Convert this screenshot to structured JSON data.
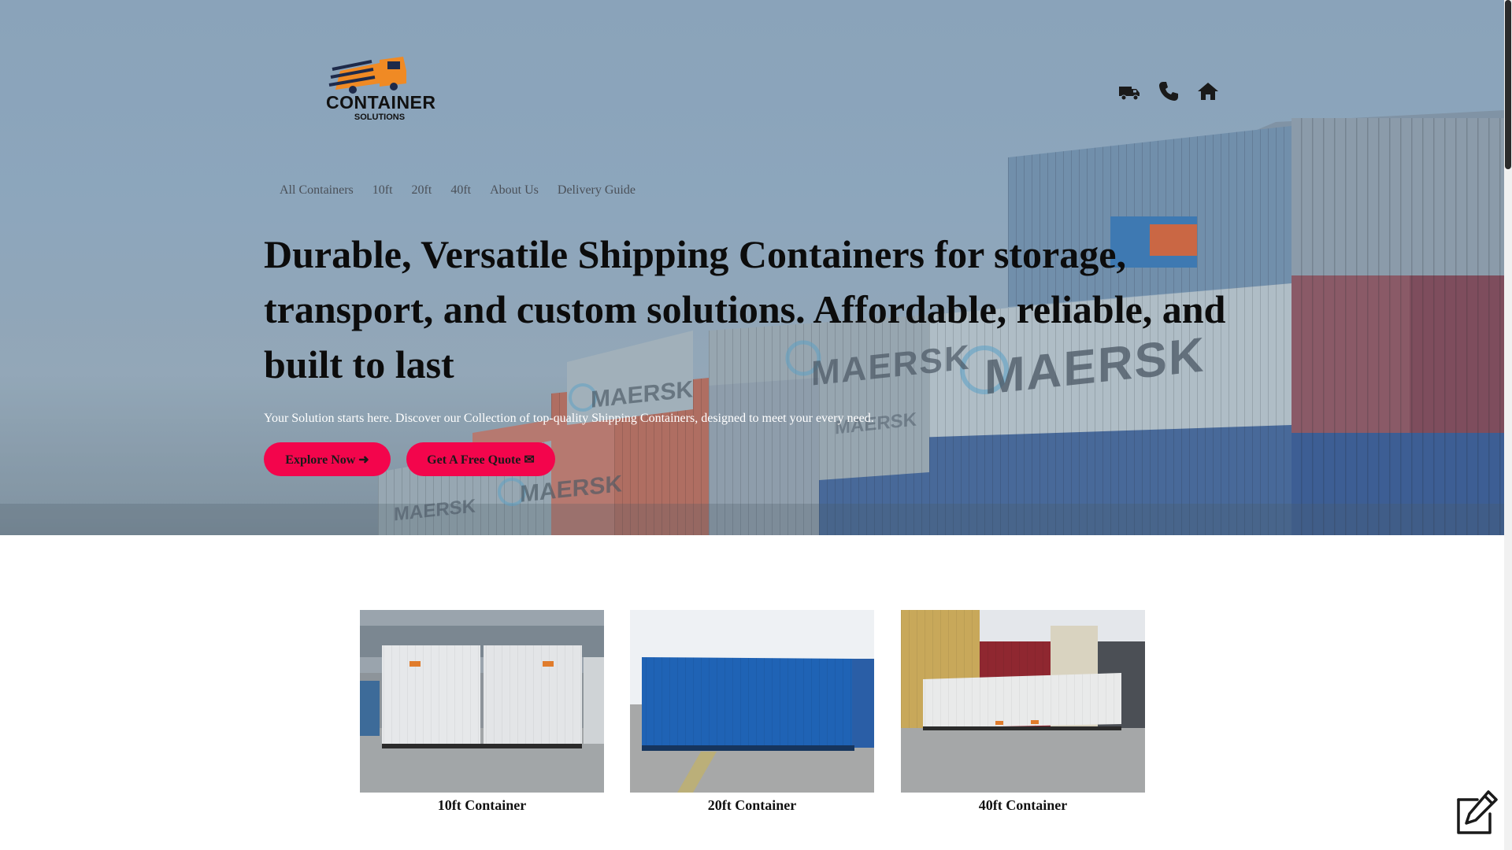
{
  "brand": {
    "logo_line1": "CONTAINER",
    "logo_line2": "SOLUTIONS"
  },
  "header_icons": [
    "truck-icon",
    "phone-icon",
    "home-icon"
  ],
  "nav": {
    "items": [
      {
        "label": "All Containers"
      },
      {
        "label": "10ft"
      },
      {
        "label": "20ft"
      },
      {
        "label": "40ft"
      },
      {
        "label": "About Us"
      },
      {
        "label": "Delivery Guide"
      }
    ]
  },
  "hero": {
    "headline": "Durable, Versatile Shipping Containers for storage, transport, and custom solutions. Affordable, reliable, and built to last",
    "subline": "Your Solution starts here. Discover our Collection of top-quality Shipping Containers, designed to meet your every need.",
    "explore_label": "Explore Now ➜",
    "quote_label": "Get A Free Quote ✉",
    "background_container_text": [
      "MAERSK",
      "MAERSK",
      "MAERSK",
      "MAERSK",
      "MAERSK",
      "MAERSK"
    ]
  },
  "products": [
    {
      "title": "10ft Container"
    },
    {
      "title": "20ft Container"
    },
    {
      "title": "40ft Container"
    }
  ],
  "colors": {
    "accent": "#f3054c",
    "logo_orange": "#f08a24",
    "logo_navy": "#1e2a4a"
  }
}
